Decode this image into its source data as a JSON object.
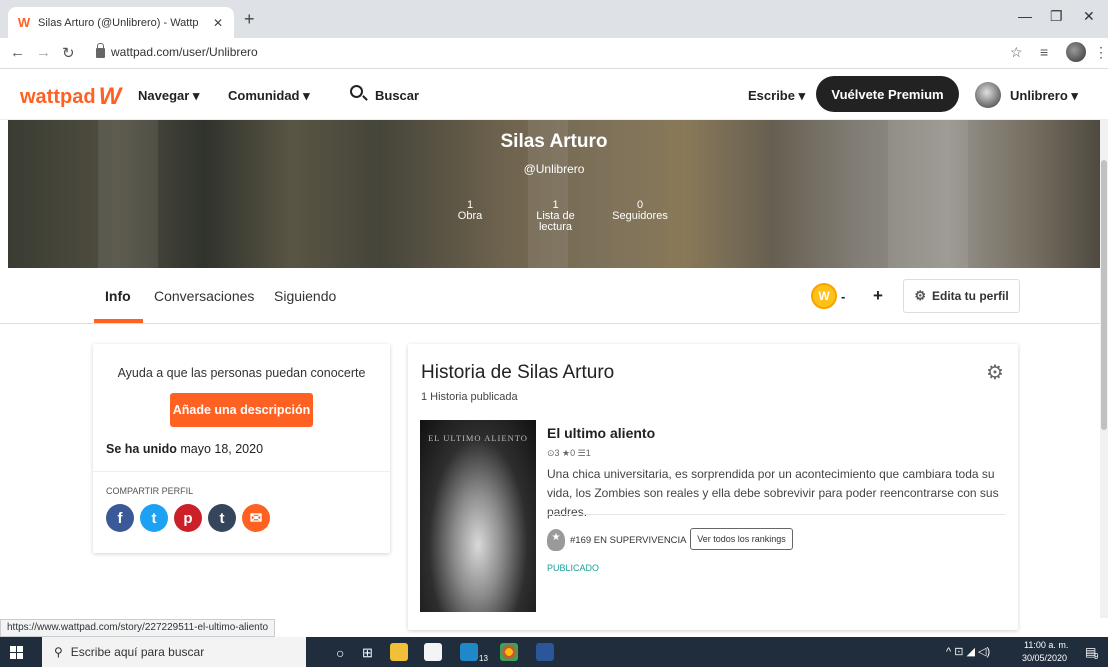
{
  "browser": {
    "tab_title": "Silas Arturo (@Unlibrero) - Wattp",
    "url": "wattpad.com/user/Unlibrero"
  },
  "header": {
    "logo": "wattpad",
    "nav_browse": "Navegar ▾",
    "nav_community": "Comunidad ▾",
    "search_label": "Buscar",
    "write": "Escribe ▾",
    "premium": "Vuélvete Premium",
    "username": "Unlibrero ▾"
  },
  "profile": {
    "name": "Silas Arturo",
    "handle": "@Unlibrero",
    "stats": [
      {
        "num": "1",
        "label": "Obra"
      },
      {
        "num": "1",
        "label": "Lista de lectura"
      },
      {
        "num": "0",
        "label": "Seguidores"
      }
    ]
  },
  "tabs": [
    "Info",
    "Conversaciones",
    "Siguiendo"
  ],
  "coins": "-",
  "edit_profile": "Edita tu perfil",
  "about": {
    "help_text": "Ayuda a que las personas puedan conocerte",
    "add_description": "Añade una descripción",
    "joined_label": "Se ha unido",
    "joined_date": "mayo 18, 2020",
    "share_label": "COMPARTIR PERFIL"
  },
  "stories": {
    "heading": "Historia de Silas Arturo",
    "count": "1 Historia publicada",
    "item": {
      "cover_text": "EL ULTIMO ALIENTO",
      "title": "El ultimo aliento",
      "meta": "⊙3 ★0 ☰1",
      "description": "Una chica universitaria, es sorprendida por un acontecimiento que cambiara toda su vida, los Zombies son reales y ella debe sobrevivir para poder reencontrarse con sus padres.",
      "rank": "#169 EN SUPERVIVENCIA",
      "rank_button": "Ver todos los rankings",
      "status": "PUBLICADO"
    }
  },
  "status_url": "https://www.wattpad.com/story/227229511-el-ultimo-aliento",
  "taskbar": {
    "search": "Escribe aquí para buscar",
    "time": "11:00 a. m.",
    "date": "30/05/2020",
    "badge_count": "13",
    "notif_count": "9"
  },
  "colors": {
    "brand": "#ff6122",
    "premium": "#222222",
    "published": "#1aa195"
  }
}
